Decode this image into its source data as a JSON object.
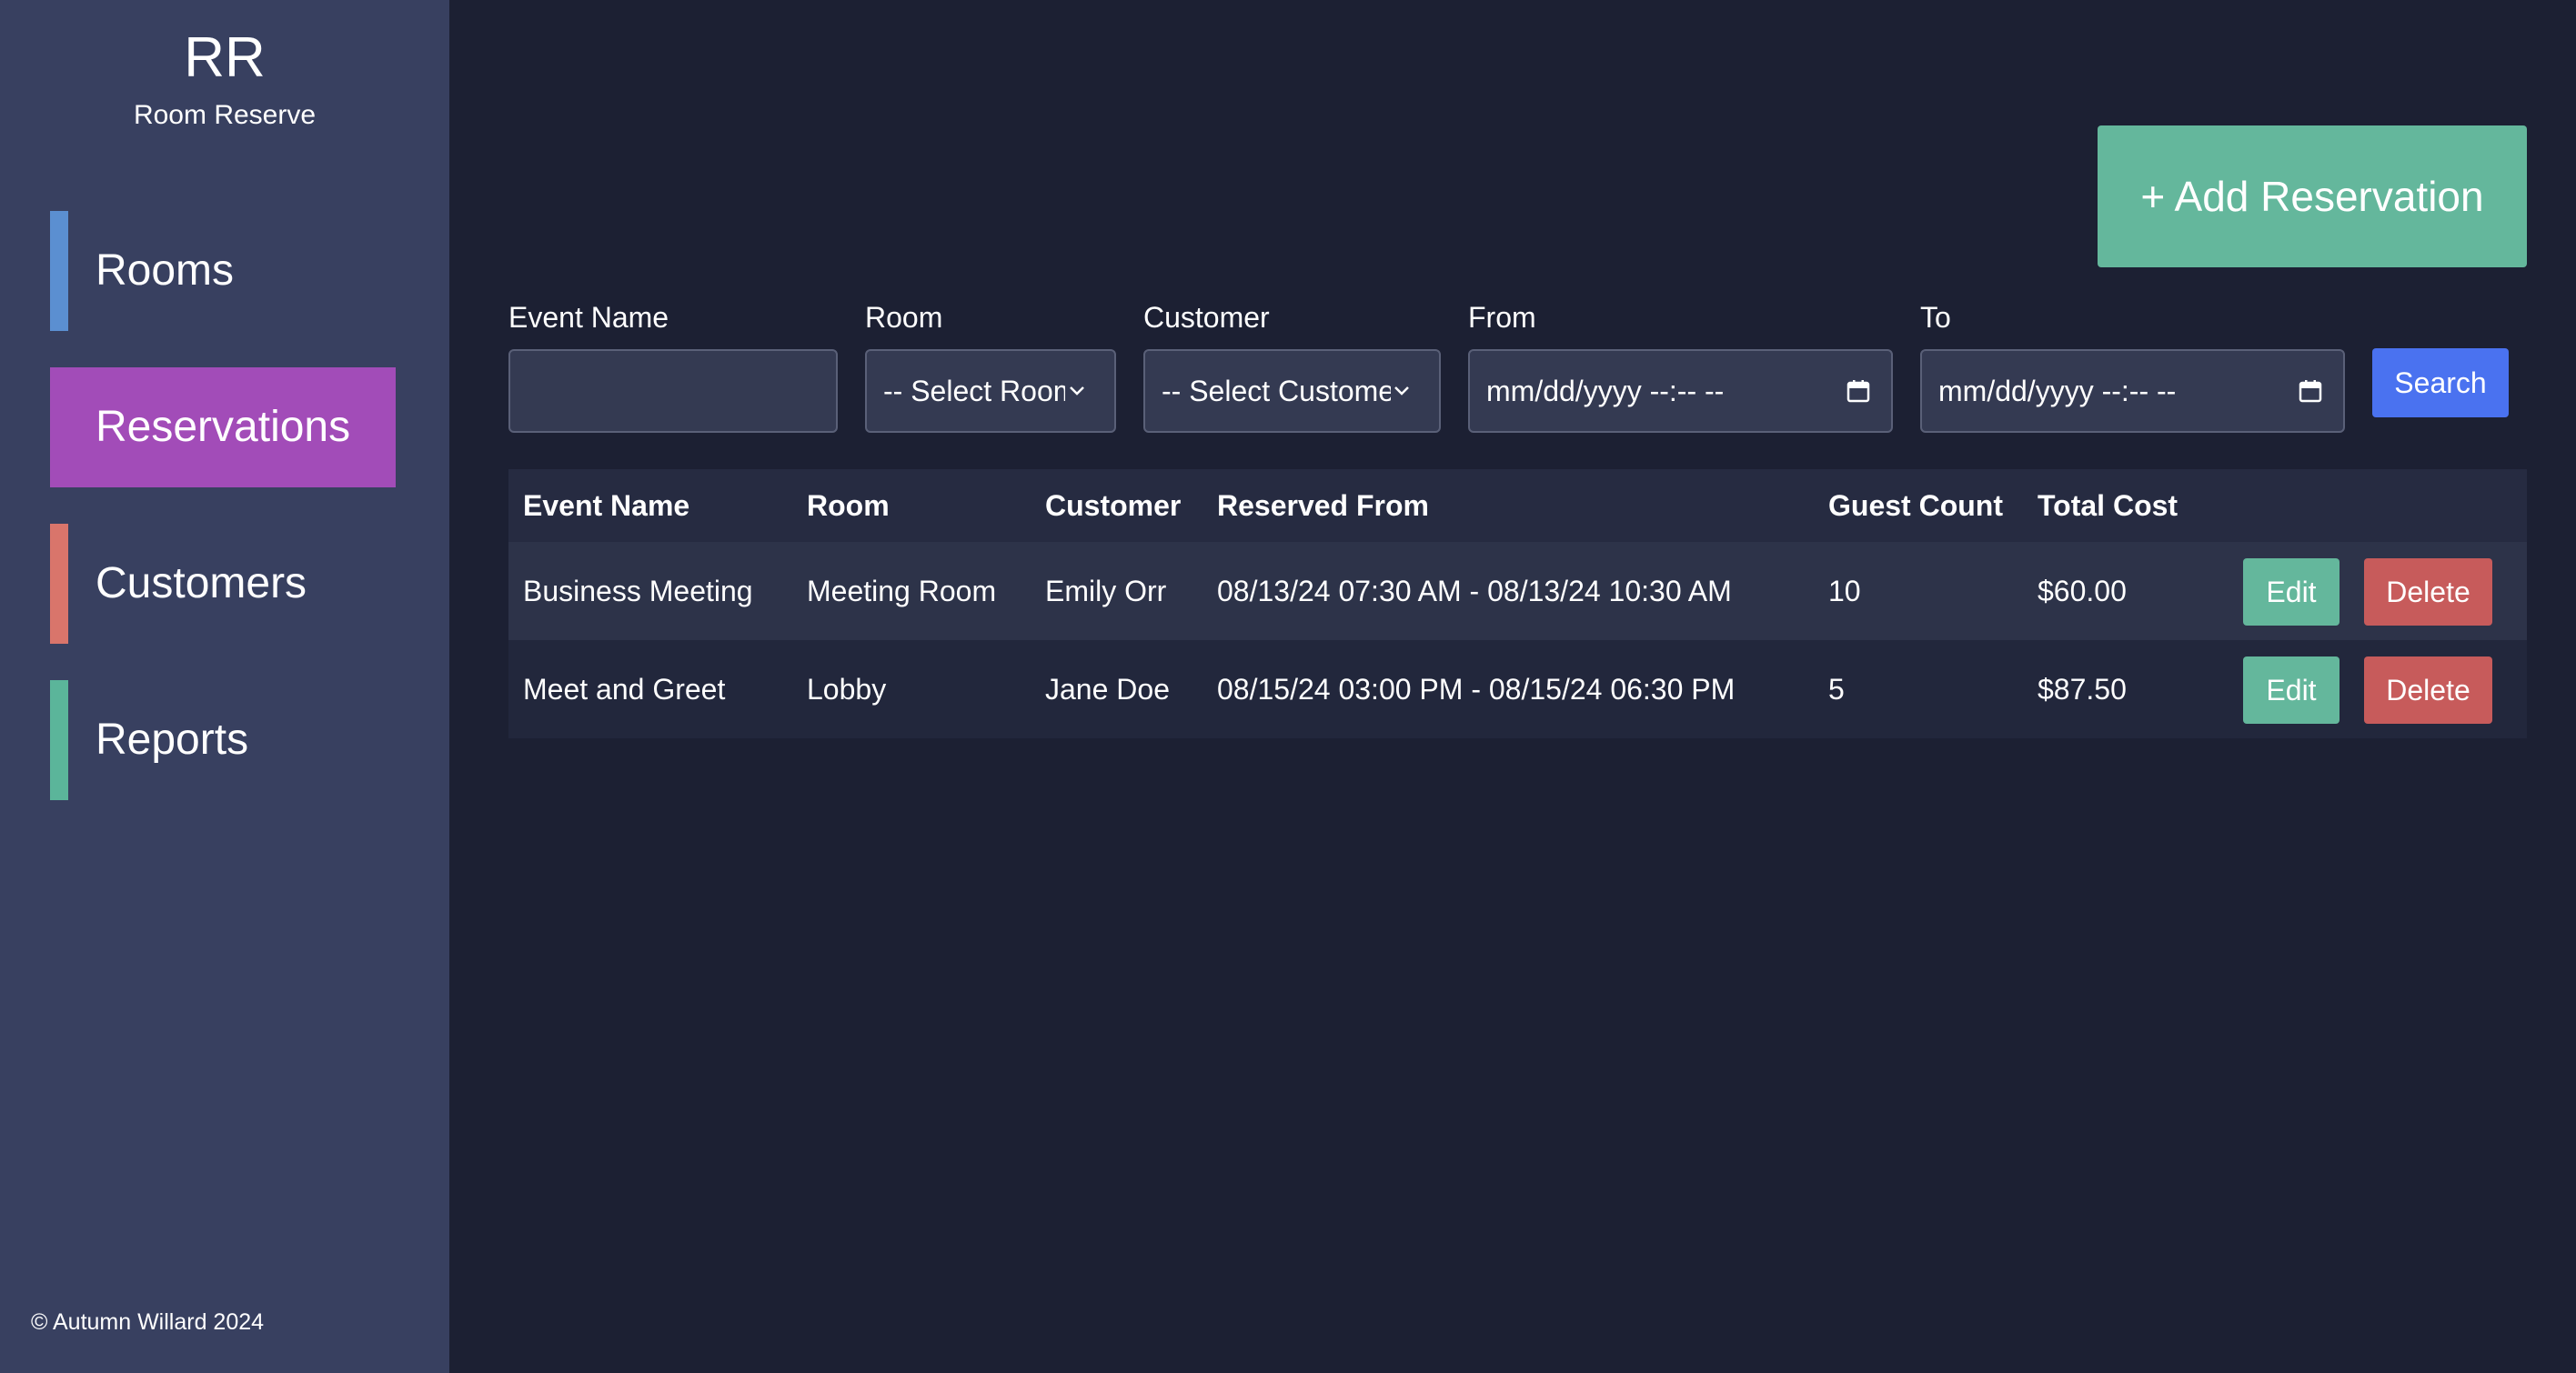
{
  "sidebar": {
    "logo": "RR",
    "brand": "Room Reserve",
    "items": [
      {
        "label": "Rooms",
        "color": "#5b8fd1",
        "active": false
      },
      {
        "label": "Reservations",
        "color": "#a24cb8",
        "active": true
      },
      {
        "label": "Customers",
        "color": "#d9756b",
        "active": false
      },
      {
        "label": "Reports",
        "color": "#5bb59a",
        "active": false
      }
    ],
    "footer": "© Autumn Willard 2024"
  },
  "toolbar": {
    "add_label": "+ Add Reservation",
    "search_label": "Search"
  },
  "filters": {
    "event_name": {
      "label": "Event Name",
      "value": ""
    },
    "room": {
      "label": "Room",
      "selected": "-- Select Room --"
    },
    "customer": {
      "label": "Customer",
      "selected": "-- Select Customer --"
    },
    "from": {
      "label": "From",
      "value": "mm/dd/yyyy --:-- --"
    },
    "to": {
      "label": "To",
      "value": "mm/dd/yyyy --:-- --"
    }
  },
  "table": {
    "columns": [
      "Event Name",
      "Room",
      "Customer",
      "Reserved From",
      "Guest Count",
      "Total Cost"
    ],
    "rows": [
      {
        "event_name": "Business Meeting",
        "room": "Meeting Room",
        "customer": "Emily Orr",
        "reserved": "08/13/24 07:30 AM - 08/13/24 10:30 AM",
        "guests": "10",
        "cost": "$60.00",
        "edit_label": "Edit",
        "delete_label": "Delete"
      },
      {
        "event_name": "Meet and Greet",
        "room": "Lobby",
        "customer": "Jane Doe",
        "reserved": "08/15/24 03:00 PM - 08/15/24 06:30 PM",
        "guests": "5",
        "cost": "$87.50",
        "edit_label": "Edit",
        "delete_label": "Delete"
      }
    ]
  },
  "colors": {
    "background": "#1c2033",
    "sidebar": "#384060",
    "accent_add": "#64b79c",
    "accent_search": "#4a72f0",
    "accent_delete": "#c75b5b"
  }
}
